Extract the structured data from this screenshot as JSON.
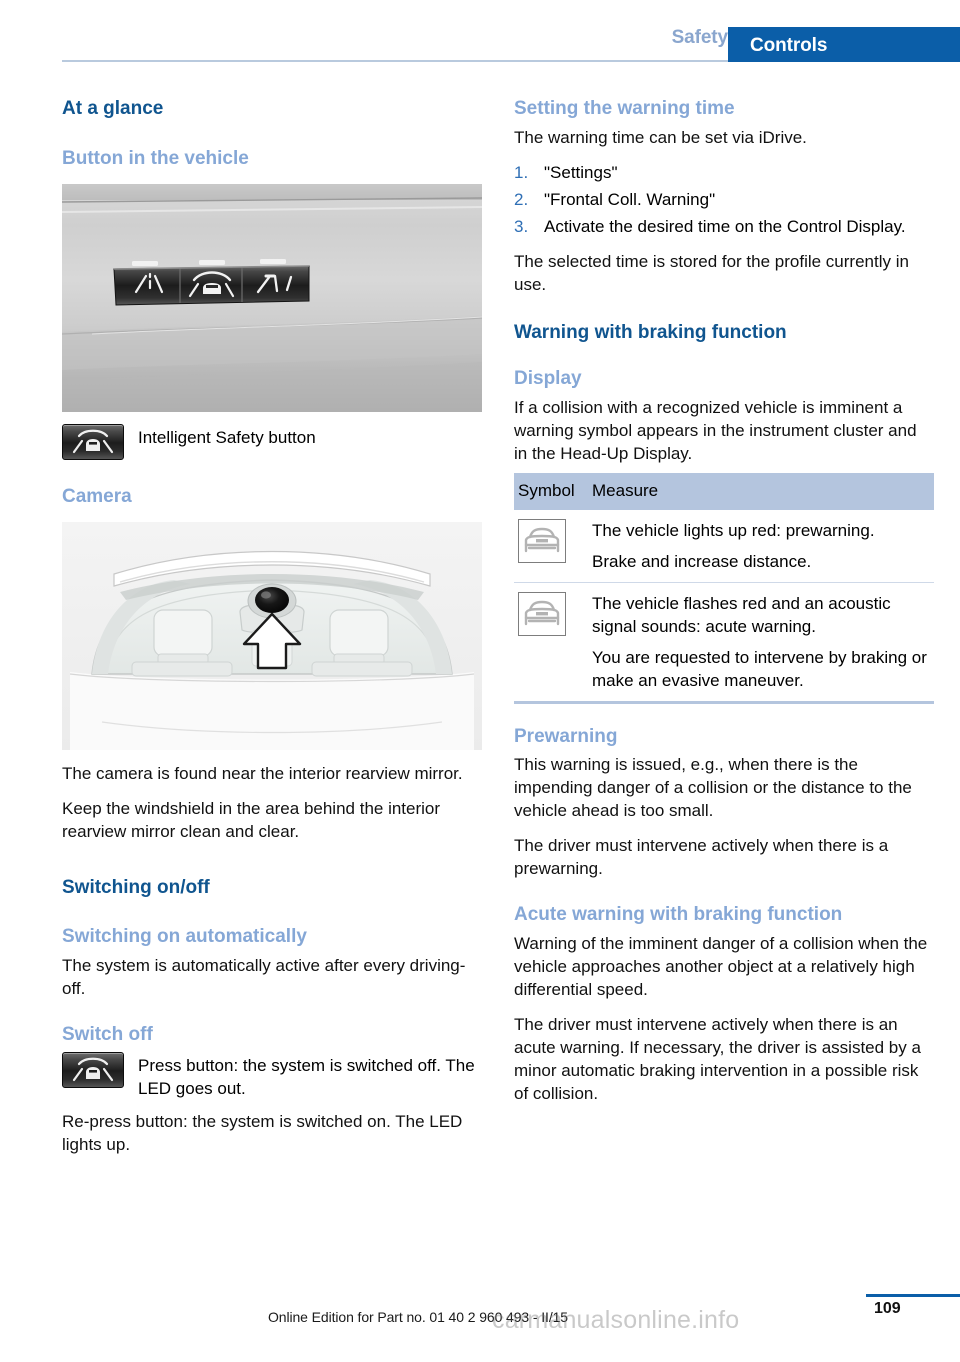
{
  "header": {
    "tab_inactive": "Safety",
    "tab_active": "Controls",
    "accent_color": "#0b5ea8",
    "muted_blue": "#8aa6ce"
  },
  "left_column": {
    "h_at_a_glance": "At a glance",
    "h_button_in_vehicle": "Button in the vehicle",
    "figure_button_caption_icon": "intelligent-safety-button-icon",
    "intelligent_safety_label": "Intelligent Safety button",
    "h_camera": "Camera",
    "camera_p1": "The camera is found near the interior rearview mirror.",
    "camera_p2": "Keep the windshield in the area behind the interior rearview mirror clean and clear.",
    "h_switching_on_off": "Switching on/off",
    "h_switching_on_automatically": "Switching on automatically",
    "switching_on_p1": "The system is automatically active after every driving-off.",
    "h_switch_off": "Switch off",
    "switch_off_icon_text": "Press button: the system is switched off. The LED goes out.",
    "switch_off_p1": "Re-press button: the system is switched on. The LED lights up."
  },
  "right_column": {
    "h_setting_warning_time": "Setting the warning time",
    "setting_p1": "The warning time can be set via iDrive.",
    "steps": [
      {
        "num": "1.",
        "text": "\"Settings\""
      },
      {
        "num": "2.",
        "text": "\"Frontal Coll. Warning\""
      },
      {
        "num": "3.",
        "text": "Activate the desired time on the Control Display."
      }
    ],
    "setting_p2": "The selected time is stored for the profile currently in use.",
    "h_warning_braking": "Warning with braking function",
    "h_display": "Display",
    "display_p1": "If a collision with a recognized vehicle is imminent a warning symbol appears in the instrument cluster and in the Head-Up Display.",
    "table": {
      "headers": [
        "Symbol",
        "Measure"
      ],
      "header_bg": "#b4c5de",
      "rows": [
        {
          "symbol": "vehicle-front-icon",
          "paragraphs": [
            "The vehicle lights up red: prewarning.",
            "Brake and increase distance."
          ]
        },
        {
          "symbol": "vehicle-front-icon",
          "paragraphs": [
            "The vehicle flashes red and an acoustic signal sounds: acute warning.",
            "You are requested to intervene by braking or make an evasive maneuver."
          ]
        }
      ]
    },
    "h_prewarning": "Prewarning",
    "prewarning_p1": "This warning is issued, e.g., when there is the impending danger of a collision or the distance to the vehicle ahead is too small.",
    "prewarning_p2": "The driver must intervene actively when there is a prewarning.",
    "h_acute_warning": "Acute warning with braking function",
    "acute_p1": "Warning of the imminent danger of a collision when the vehicle approaches another object at a relatively high differential speed.",
    "acute_p2": "The driver must intervene actively when there is an acute warning. If necessary, the driver is assisted by a minor automatic braking intervention in a possible risk of collision."
  },
  "footer": {
    "note": "Online Edition for Part no. 01 40 2 960 493 - II/15",
    "page_number": "109",
    "watermark": "carmanualsonline.info"
  }
}
